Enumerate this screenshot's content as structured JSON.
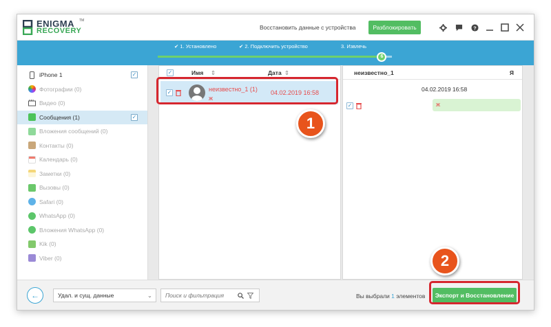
{
  "app": {
    "logo_line1": "ENIGMA",
    "logo_line2": "RECOVERY",
    "logo_tm": "TM",
    "restore_link": "Восстановить данные с устройства",
    "unlock_button": "Разблокировать",
    "accent_color": "#3ba5d4",
    "green_color": "#52bd62",
    "red_color": "#d6262e"
  },
  "steps": [
    {
      "label": "1. Установлено",
      "done": true
    },
    {
      "label": "2. Подключить устройство",
      "done": true
    },
    {
      "label": "3. Извлечь",
      "done": false
    }
  ],
  "progress": {
    "knob_label": "6",
    "fraction": 0.96
  },
  "sidebar": {
    "items": [
      {
        "label": "iPhone 1",
        "icon": "phone-icon",
        "checked": true
      },
      {
        "label": "Фотографии (0)",
        "icon": "photos-icon"
      },
      {
        "label": "Видео (0)",
        "icon": "video-icon"
      },
      {
        "label": "Сообщения (1)",
        "icon": "messages-icon",
        "checked": true,
        "active": true
      },
      {
        "label": "Вложения сообщений (0)",
        "icon": "attachments-icon"
      },
      {
        "label": "Контакты (0)",
        "icon": "contacts-icon"
      },
      {
        "label": "Календарь (0)",
        "icon": "calendar-icon"
      },
      {
        "label": "Заметки (0)",
        "icon": "notes-icon"
      },
      {
        "label": "Вызовы (0)",
        "icon": "calls-icon"
      },
      {
        "label": "Safari (0)",
        "icon": "safari-icon"
      },
      {
        "label": "WhatsApp (0)",
        "icon": "whatsapp-icon"
      },
      {
        "label": "Вложения WhatsApp (0)",
        "icon": "whatsapp-attachments-icon"
      },
      {
        "label": "Kik (0)",
        "icon": "kik-icon"
      },
      {
        "label": "Viber (0)",
        "icon": "viber-icon"
      }
    ]
  },
  "list": {
    "col_name": "Имя",
    "col_date": "Дата",
    "sort_glyph": "⇕",
    "sort_glyph_date": "⇕",
    "rows": [
      {
        "name": "неизвестно_1 (1)",
        "date": "04.02.2019 16:58",
        "preview": "ж"
      }
    ]
  },
  "detail": {
    "contact": "неизвестно_1",
    "me_label": "Я",
    "date": "04.02.2019 16:58",
    "message": "ж"
  },
  "footer": {
    "back_glyph": "←",
    "filter_select": "Удал. и сущ. данные",
    "search_placeholder": "Поиск и фильтрация",
    "selected_prefix": "Вы выбрали",
    "selected_count": "1",
    "selected_suffix": "элементов",
    "export_button": "Экспорт и Восстановление"
  },
  "annotations": {
    "badge1": "1",
    "badge2": "2"
  }
}
